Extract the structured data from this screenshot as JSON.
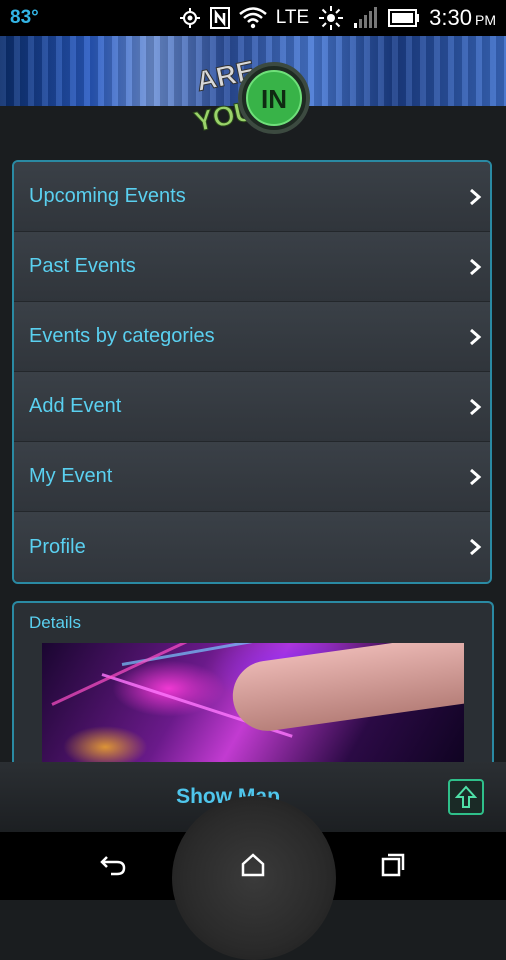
{
  "status_bar": {
    "temperature": "83°",
    "network": "LTE",
    "time": "3:30",
    "ampm": "PM",
    "icons": [
      "gps-icon",
      "nfc-icon",
      "wifi-icon",
      "brightness-icon",
      "signal-icon",
      "battery-icon"
    ]
  },
  "header": {
    "logo_line1": "ARE",
    "logo_line2": "YOU",
    "logo_badge": "IN"
  },
  "menu": {
    "items": [
      {
        "label": "Upcoming Events"
      },
      {
        "label": "Past Events"
      },
      {
        "label": "Events by categories"
      },
      {
        "label": "Add Event"
      },
      {
        "label": "My Event"
      },
      {
        "label": "Profile"
      }
    ]
  },
  "details": {
    "title": "Details"
  },
  "bottom_bar": {
    "show_map_label": "Show Map"
  },
  "colors": {
    "accent": "#5ad0f0",
    "panel_border": "#2a8aa3",
    "panel_bg": "#30353b",
    "up_button": "#2fbf8a"
  }
}
